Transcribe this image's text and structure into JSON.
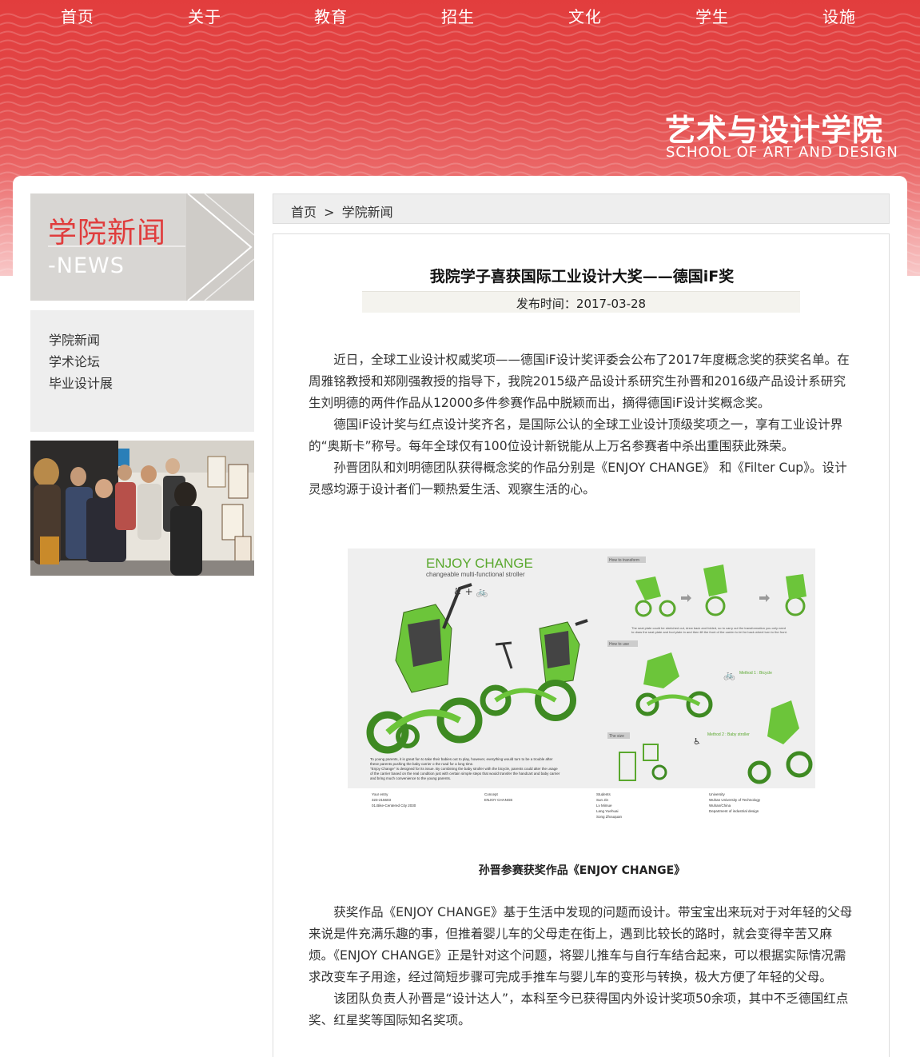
{
  "nav": {
    "items": [
      "首页",
      "关于",
      "教育",
      "招生",
      "文化",
      "学生",
      "设施"
    ]
  },
  "header": {
    "logo_cn": "艺术与设计学院",
    "logo_en": "SCHOOL OF ART AND DESIGN"
  },
  "sidebar": {
    "title_cn": "学院新闻",
    "title_en": "-NEWS",
    "menu": [
      "学院新闻",
      "学术论坛",
      "毕业设计展"
    ]
  },
  "breadcrumb": {
    "home": "首页",
    "separator": ">",
    "current": "学院新闻"
  },
  "article": {
    "title": "我院学子喜获国际工业设计大奖——德国iF奖",
    "date": "发布时间：2017-03-28",
    "paragraphs_top": [
      "近日，全球工业设计权威奖项——德国iF设计奖评委会公布了2017年度概念奖的获奖名单。在周雅铭教授和郑刚强教授的指导下，我院2015级产品设计系研究生孙晋和2016级产品设计系研究生刘明德的两件作品从12000多件参赛作品中脱颖而出，摘得德国iF设计奖概念奖。",
      "德国iF设计奖与红点设计奖齐名，是国际公认的全球工业设计顶级奖项之一，享有工业设计界的“奥斯卡”称号。每年全球仅有100位设计新锐能从上万名参赛者中杀出重围获此殊荣。",
      "孙晋团队和刘明德团队获得概念奖的作品分别是《ENJOY CHANGE》 和《Filter Cup》。设计灵感均源于设计者们一颗热爱生活、观察生活的心。"
    ],
    "figure": {
      "title": "ENJOY CHANGE",
      "subtitle": "changeable multi-functional stroller",
      "how_transform": "How to transform",
      "how_use": "How to use",
      "size": "The size",
      "method1": "Method 1 : Bicycle",
      "method2": "Method 2 : Baby stroller",
      "credit_entry_label": "Your entry",
      "credit_entry": "323-215603",
      "credit_entry2": "01.Bike-Centered City 2030",
      "credit_concept_label": "Concept",
      "credit_concept": "ENJOY CHANGE",
      "credit_students_label": "Students",
      "credit_students": [
        "Sun Jin",
        "Lv Mimue",
        "Lang Yuehuai",
        "Song Zhouquan"
      ],
      "credit_univ_label": "University",
      "credit_univ": [
        "Wuhan University of Technology",
        "Wuhan/China",
        "Department of industrial design"
      ]
    },
    "caption": "孙晋参赛获奖作品《ENJOY CHANGE》",
    "paragraphs_bottom": [
      "获奖作品《ENJOY CHANGE》基于生活中发现的问题而设计。带宝宝出来玩对于对年轻的父母来说是件充满乐趣的事，但推着婴儿车的父母走在街上，遇到比较长的路时，就会变得辛苦又麻烦。《ENJOY CHANGE》正是针对这个问题，将婴儿推车与自行车结合起来，可以根据实际情况需求改变车子用途，经过简短步骤可完成手推车与婴儿车的变形与转换，极大方便了年轻的父母。",
      "该团队负责人孙晋是“设计达人”，本科至今已获得国内外设计奖项50余项，其中不乏德国红点奖、红星奖等国际知名奖项。"
    ]
  },
  "colors": {
    "brand_red": "#e03c3c",
    "accent_green": "#6cc53a"
  }
}
